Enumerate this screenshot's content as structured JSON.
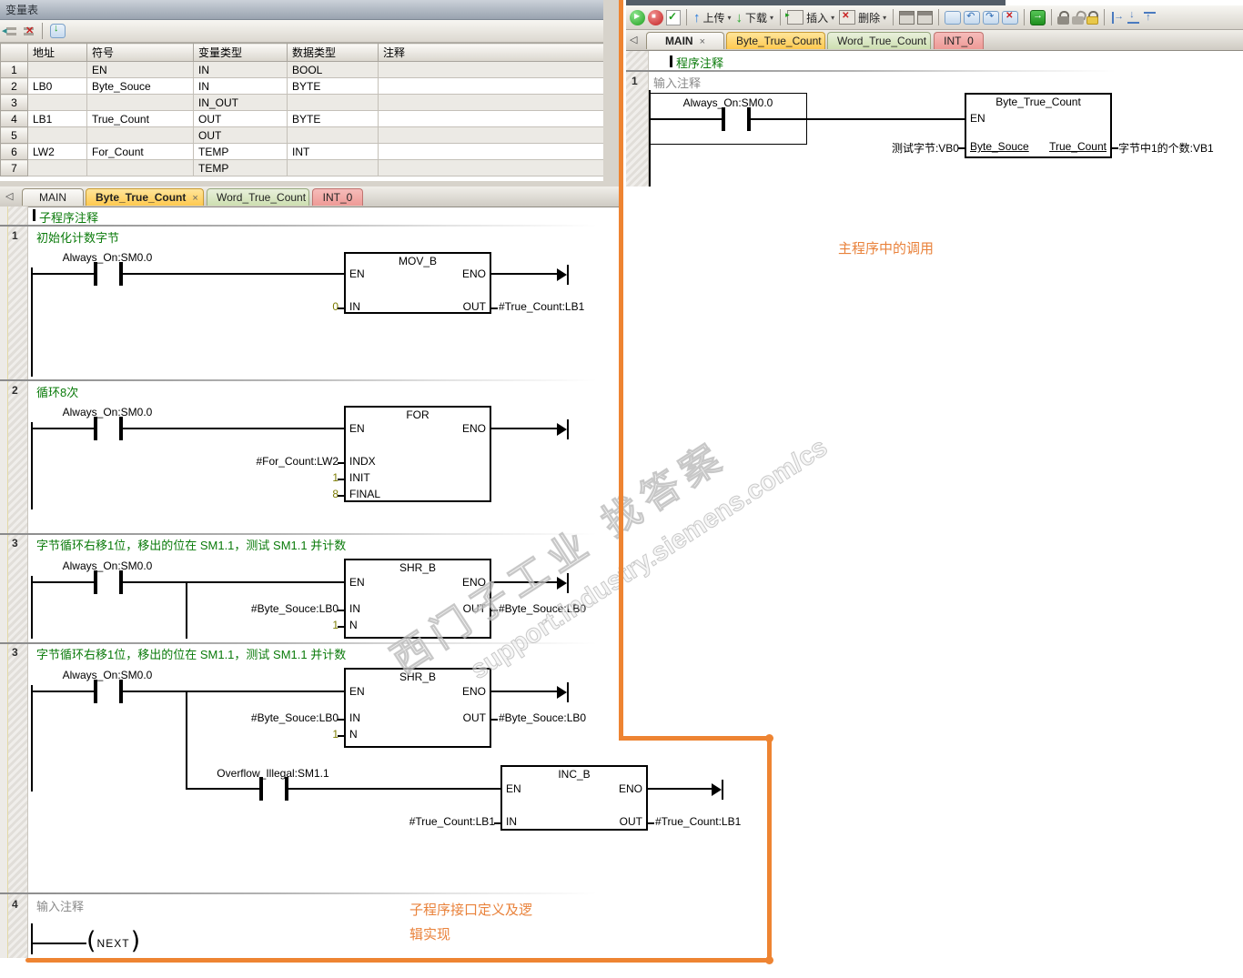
{
  "colors": {
    "accent_orange": "#EE8432",
    "comment_green": "#0B7B0B",
    "constant_olive": "#7B7B00",
    "tab_yellow": "#FFC94F",
    "tab_green": "#CDDFB0",
    "tab_pink": "#EE9A96"
  },
  "icons": {
    "play": "▶",
    "stop": "■",
    "check": "✓",
    "up_arrow": "↑",
    "down_arrow": "↓",
    "dropdown": "▾",
    "close": "×",
    "scroll_left": "◁"
  },
  "var_table": {
    "title": "变量表",
    "columns": [
      "地址",
      "符号",
      "变量类型",
      "数据类型",
      "注释"
    ],
    "rows": [
      {
        "n": "1",
        "addr": "",
        "sym": "EN",
        "vtype": "IN",
        "dtype": "BOOL",
        "comment": ""
      },
      {
        "n": "2",
        "addr": "LB0",
        "sym": "Byte_Souce",
        "vtype": "IN",
        "dtype": "BYTE",
        "comment": ""
      },
      {
        "n": "3",
        "addr": "",
        "sym": "",
        "vtype": "IN_OUT",
        "dtype": "",
        "comment": ""
      },
      {
        "n": "4",
        "addr": "LB1",
        "sym": "True_Count",
        "vtype": "OUT",
        "dtype": "BYTE",
        "comment": ""
      },
      {
        "n": "5",
        "addr": "",
        "sym": "",
        "vtype": "OUT",
        "dtype": "",
        "comment": ""
      },
      {
        "n": "6",
        "addr": "LW2",
        "sym": "For_Count",
        "vtype": "TEMP",
        "dtype": "INT",
        "comment": ""
      },
      {
        "n": "7",
        "addr": "",
        "sym": "",
        "vtype": "TEMP",
        "dtype": "",
        "comment": ""
      }
    ]
  },
  "toolbar": {
    "upload_label": "上传",
    "download_label": "下载",
    "insert_label": "插入",
    "delete_label": "删除"
  },
  "tabs": {
    "main": "MAIN",
    "byte": "Byte_True_Count",
    "word": "Word_True_Count",
    "int0": "INT_0"
  },
  "right_panel": {
    "program_comment": "程序注释",
    "network1": {
      "num": "1",
      "comment": "输入注释",
      "contact": "Always_On:SM0.0",
      "block": {
        "title": "Byte_True_Count",
        "en": "EN",
        "in_label": "Byte_Souce",
        "out_label": "True_Count",
        "in_operand": "测试字节:VB0",
        "out_operand": "字节中1的个数:VB1"
      }
    },
    "annotation": "主程序中的调用"
  },
  "left_panel": {
    "subroutine_comment": "子程序注释",
    "annotation_line1": "子程序接口定义及逻",
    "annotation_line2": "辑实现",
    "networks": [
      {
        "num": "1",
        "comment": "初始化计数字节",
        "contact": "Always_On:SM0.0",
        "block": {
          "title": "MOV_B",
          "tl": "EN",
          "tr": "ENO",
          "left_pins": [
            {
              "label": "IN",
              "operand": "0"
            }
          ],
          "right_pins": [
            {
              "label": "OUT",
              "operand": "#True_Count:LB1"
            }
          ]
        }
      },
      {
        "num": "2",
        "comment": "循环8次",
        "contact": "Always_On:SM0.0",
        "block": {
          "title": "FOR",
          "tl": "EN",
          "tr": "ENO",
          "left_pins": [
            {
              "label": "INDX",
              "operand": "#For_Count:LW2"
            },
            {
              "label": "INIT",
              "operand": "1"
            },
            {
              "label": "FINAL",
              "operand": "8"
            }
          ],
          "right_pins": []
        }
      },
      {
        "num": "3",
        "comment": "字节循环右移1位，移出的位在 SM1.1，测试 SM1.1 并计数",
        "contact": "Always_On:SM0.0",
        "block": {
          "title": "SHR_B",
          "tl": "EN",
          "tr": "ENO",
          "left_pins": [
            {
              "label": "IN",
              "operand": "#Byte_Souce:LB0"
            },
            {
              "label": "N",
              "operand": "1"
            }
          ],
          "right_pins": [
            {
              "label": "OUT",
              "operand": "#Byte_Souce:LB0"
            }
          ]
        }
      },
      {
        "num": "3",
        "comment": "字节循环右移1位，移出的位在 SM1.1，测试 SM1.1 并计数",
        "contact": "Always_On:SM0.0",
        "block": {
          "title": "SHR_B",
          "tl": "EN",
          "tr": "ENO",
          "left_pins": [
            {
              "label": "IN",
              "operand": "#Byte_Souce:LB0"
            },
            {
              "label": "N",
              "operand": "1"
            }
          ],
          "right_pins": [
            {
              "label": "OUT",
              "operand": "#Byte_Souce:LB0"
            }
          ]
        },
        "branch": {
          "contact": "Overflow_Illegal:SM1.1",
          "block": {
            "title": "INC_B",
            "tl": "EN",
            "tr": "ENO",
            "left_pins": [
              {
                "label": "IN",
                "operand": "#True_Count:LB1"
              }
            ],
            "right_pins": [
              {
                "label": "OUT",
                "operand": "#True_Count:LB1"
              }
            ]
          }
        }
      },
      {
        "num": "4",
        "comment": "输入注释",
        "coil": "NEXT"
      }
    ]
  },
  "watermark": {
    "line1": "西门子工业 找答案",
    "line2": "support.industry.siemens.com/cs"
  }
}
